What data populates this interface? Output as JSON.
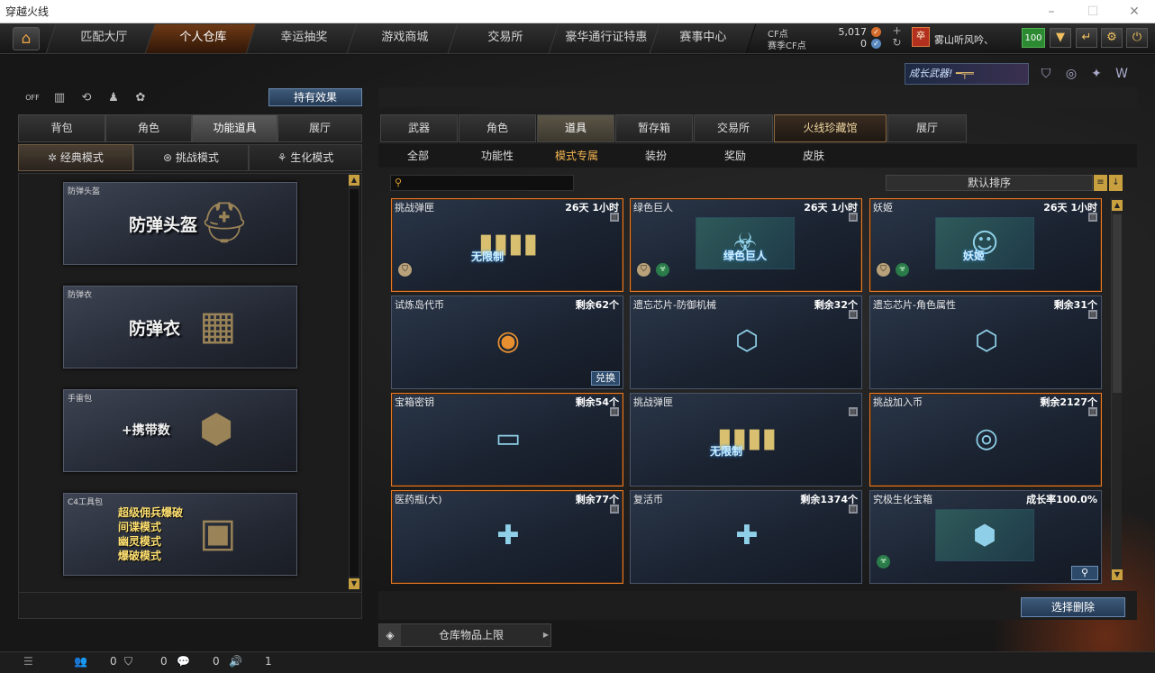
{
  "window": {
    "title": "穿越火线"
  },
  "nav": {
    "tabs": [
      "匹配大厅",
      "个人仓库",
      "幸运抽奖",
      "游戏商城",
      "交易所",
      "豪华通行证特惠",
      "赛事中心"
    ],
    "active_index": 1
  },
  "currency": {
    "cf_label": "CF点",
    "cf_value": "5,017",
    "season_label": "赛季CF点",
    "season_value": "0"
  },
  "player": {
    "name": "雾山听风吟、",
    "level": "100"
  },
  "banner": {
    "text": "成长武器!"
  },
  "left": {
    "effect_button": "持有效果",
    "tabs": [
      "背包",
      "角色",
      "功能道具",
      "展厅"
    ],
    "active_tab": 2,
    "modes": [
      {
        "label": "经典模式",
        "icon": "crosshair-icon"
      },
      {
        "label": "挑战模式",
        "icon": "challenge-icon"
      },
      {
        "label": "生化模式",
        "icon": "biohazard-icon"
      }
    ],
    "cards": [
      {
        "caption": "防弹头盔",
        "title": "防弹头盔",
        "icon": "helmet-icon"
      },
      {
        "caption": "防弹衣",
        "title": "防弹衣",
        "icon": "vest-icon"
      },
      {
        "caption": "手雷包",
        "title": "+携带数",
        "icon": "grenade-icon"
      },
      {
        "caption": "C4工具包",
        "lines": [
          "超级佣兵爆破",
          "间谍模式",
          "幽灵模式",
          "爆破模式"
        ],
        "icon": "c4-icon"
      }
    ]
  },
  "right": {
    "tabs": [
      "武器",
      "角色",
      "道具",
      "暂存箱",
      "交易所",
      "火线珍藏馆",
      "展厅"
    ],
    "active_tab": 2,
    "subtabs": [
      "全部",
      "功能性",
      "模式专属",
      "装扮",
      "奖励",
      "皮肤"
    ],
    "active_subtab": 2,
    "sort_label": "默认排序",
    "items": [
      {
        "name": "挑战弹匣",
        "value": "26天 1小时",
        "hl": true,
        "img_text": "无限制",
        "icons": [
          "shield"
        ]
      },
      {
        "name": "绿色巨人",
        "value": "26天 1小时",
        "hl": true,
        "img_text": "绿色巨人",
        "icons": [
          "shield",
          "bio"
        ]
      },
      {
        "name": "妖姬",
        "value": "26天 1小时",
        "hl": true,
        "img_text": "妖姬",
        "icons": [
          "shield",
          "bio"
        ]
      },
      {
        "name": "试炼岛代币",
        "value": "剩余62个",
        "hl": false,
        "img_text": "",
        "button": "兑换",
        "icons": []
      },
      {
        "name": "遗忘芯片-防御机械",
        "value": "剩余32个",
        "hl": false,
        "img_text": "",
        "icons": []
      },
      {
        "name": "遗忘芯片-角色属性",
        "value": "剩余31个",
        "hl": false,
        "img_text": "",
        "icons": []
      },
      {
        "name": "宝箱密钥",
        "value": "剩余54个",
        "hl": true,
        "img_text": "",
        "icons": []
      },
      {
        "name": "挑战弹匣",
        "value": "",
        "hl": false,
        "img_text": "无限制",
        "icons": []
      },
      {
        "name": "挑战加入币",
        "value": "剩余2127个",
        "hl": true,
        "img_text": "",
        "icons": []
      },
      {
        "name": "医药瓶(大)",
        "value": "剩余77个",
        "hl": true,
        "img_text": "",
        "icons": []
      },
      {
        "name": "复活币",
        "value": "剩余1374个",
        "hl": false,
        "img_text": "",
        "icons": []
      },
      {
        "name": "究极生化宝箱",
        "value": "成长率100.0%",
        "hl": false,
        "img_text": "",
        "icons": [
          "bio"
        ],
        "search": true
      }
    ],
    "delete_button": "选择删除"
  },
  "store": {
    "label": "仓库物品上限"
  },
  "statusbar": {
    "friends": "0",
    "clan": "0",
    "chat": "0",
    "volume": "1"
  }
}
